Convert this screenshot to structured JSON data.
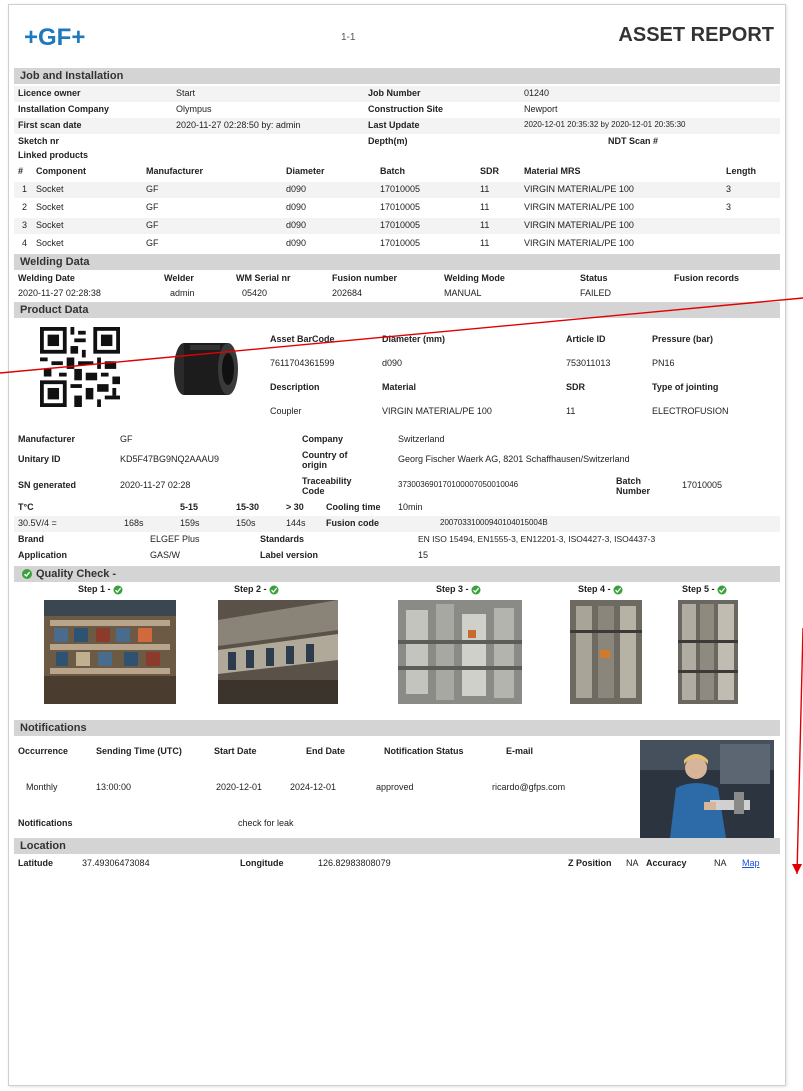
{
  "header": {
    "logo": "+GF+",
    "page_number": "1-1",
    "title": "ASSET REPORT"
  },
  "job": {
    "section_title": "Job and Installation",
    "license_owner_label": "Licence owner",
    "license_owner": "Start",
    "job_number_label": "Job Number",
    "job_number": "01240",
    "installation_company_label": "Installation Company",
    "installation_company": "Olympus",
    "construction_site_label": "Construction Site",
    "construction_site": "Newport",
    "first_scan_label": "First scan date",
    "first_scan": "2020-11-27 02:28:50 by: admin",
    "last_update_label": "Last Update",
    "last_update": "2020-12-01 20:35:32 by 2020-12-01 20:35:30",
    "sketch_label": "Sketch nr",
    "depth_label": "Depth(m)",
    "ndt_label": "NDT Scan #",
    "linked_products_label": "Linked products",
    "components": {
      "headers": [
        "#",
        "Component",
        "Manufacturer",
        "Diameter",
        "Batch",
        "SDR",
        "Material MRS",
        "Length"
      ],
      "rows": [
        [
          "1",
          "Socket",
          "GF",
          "d090",
          "17010005",
          "11",
          "VIRGIN MATERIAL/PE 100",
          "3"
        ],
        [
          "2",
          "Socket",
          "GF",
          "d090",
          "17010005",
          "11",
          "VIRGIN MATERIAL/PE 100",
          "3"
        ],
        [
          "3",
          "Socket",
          "GF",
          "d090",
          "17010005",
          "11",
          "VIRGIN MATERIAL/PE 100",
          ""
        ],
        [
          "4",
          "Socket",
          "GF",
          "d090",
          "17010005",
          "11",
          "VIRGIN MATERIAL/PE 100",
          ""
        ]
      ]
    }
  },
  "welding": {
    "section_title": "Welding Data",
    "headers": [
      "Welding Date",
      "Welder",
      "WM Serial nr",
      "Fusion number",
      "Welding Mode",
      "Status",
      "Fusion records"
    ],
    "values": [
      "2020-11-27 02:28:38",
      "admin",
      "05420",
      "202684",
      "MANUAL",
      "FAILED",
      ""
    ]
  },
  "product": {
    "section_title": "Product Data",
    "table_headers1": [
      "Asset BarCode",
      "Diameter (mm)",
      "Article ID",
      "Pressure (bar)"
    ],
    "table_values1": [
      "7611704361599",
      "d090",
      "753011013",
      "PN16"
    ],
    "table_headers2": [
      "Description",
      "Material",
      "SDR",
      "Type of jointing"
    ],
    "table_values2": [
      "Coupler",
      "VIRGIN MATERIAL/PE 100",
      "11",
      "ELECTROFUSION"
    ],
    "manufacturer_label": "Manufacturer",
    "manufacturer": "GF",
    "company_label": "Company",
    "company": "Switzerland",
    "unitary_label": "Unitary ID",
    "unitary": "KD5F47BG9NQ2AAAU9",
    "origin_label": "Country of origin",
    "origin": "Georg Fischer Waerk AG, 8201 Schaffhausen/Switzerland",
    "sn_label": "SN generated",
    "sn": "2020-11-27 02:28",
    "trace_label": "Traceability Code",
    "trace": "373003690170100007050010046",
    "batch_label": "Batch Number",
    "batch": "17010005",
    "temp_label": "T°C",
    "temp_cols": [
      "5-15",
      "15-30",
      "> 30"
    ],
    "cooling_label": "Cooling time",
    "cooling": "10min",
    "temp_row_label": "30.5V/4 =",
    "temp_vals": [
      "168s",
      "159s",
      "150s",
      "144s"
    ],
    "fusion_code_label": "Fusion code",
    "fusion_code": "20070331000940104015004B",
    "brand_label": "Brand",
    "brand": "ELGEF Plus",
    "standards_label": "Standards",
    "standards": "EN ISO 15494, EN1555-3, EN12201-3, ISO4427-3, ISO4437-3",
    "application_label": "Application",
    "application": "GAS/W",
    "label_version_label": "Label version",
    "label_version": "15"
  },
  "quality": {
    "section_title": "Quality Check -",
    "steps": [
      "Step 1 -",
      "Step 2 -",
      "Step 3 -",
      "Step 4 -",
      "Step 5 -"
    ]
  },
  "notifications": {
    "section_title": "Notifications",
    "headers": [
      "Occurrence",
      "Sending Time (UTC)",
      "Start Date",
      "End Date",
      "Notification Status",
      "E-mail"
    ],
    "values": [
      "Monthly",
      "13:00:00",
      "2020-12-01",
      "2024-12-01",
      "approved",
      "ricardo@gfps.com"
    ],
    "notifications_label": "Notifications",
    "notifications_value": "check for leak"
  },
  "location": {
    "section_title": "Location",
    "lat_label": "Latitude",
    "lat": "37.49306473084",
    "lon_label": "Longitude",
    "lon": "126.82983808079",
    "z_label": "Z Position",
    "z": "NA",
    "acc_label": "Accuracy",
    "acc": "NA",
    "map_link": "Map"
  },
  "colors": {
    "logo": "#1d78bd",
    "section_bg": "#d4d4d4",
    "annotation_line": "#e00000",
    "check_green": "#3aa23a",
    "link": "#1a4fd6"
  }
}
